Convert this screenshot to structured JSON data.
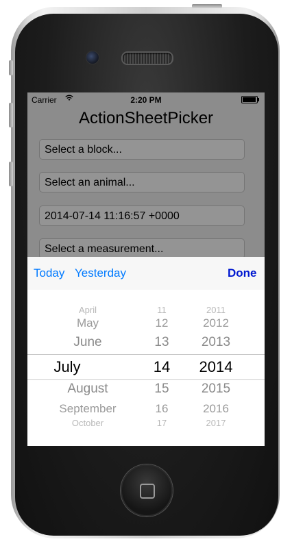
{
  "status_bar": {
    "carrier": "Carrier",
    "time": "2:20 PM",
    "wifi_icon": "wifi-icon",
    "battery_icon": "battery-icon"
  },
  "app": {
    "title": "ActionSheetPicker",
    "fields": {
      "block": "Select a block...",
      "animal": "Select an animal...",
      "date": "2014-07-14 11:16:57 +0000",
      "measurement": "Select a measurement..."
    }
  },
  "picker_sheet": {
    "toolbar": {
      "today": "Today",
      "yesterday": "Yesterday",
      "done": "Done"
    },
    "columns": {
      "month": {
        "visible": [
          "April",
          "May",
          "June",
          "July",
          "August",
          "September",
          "October"
        ],
        "selected": "July"
      },
      "day": {
        "visible": [
          "11",
          "12",
          "13",
          "14",
          "15",
          "16",
          "17"
        ],
        "selected": "14"
      },
      "year": {
        "visible": [
          "2011",
          "2012",
          "2013",
          "2014",
          "2015",
          "2016",
          "2017"
        ],
        "selected": "2014"
      }
    }
  },
  "colors": {
    "accent": "#007aff",
    "done": "#0018d0",
    "overlay": "#000000"
  }
}
